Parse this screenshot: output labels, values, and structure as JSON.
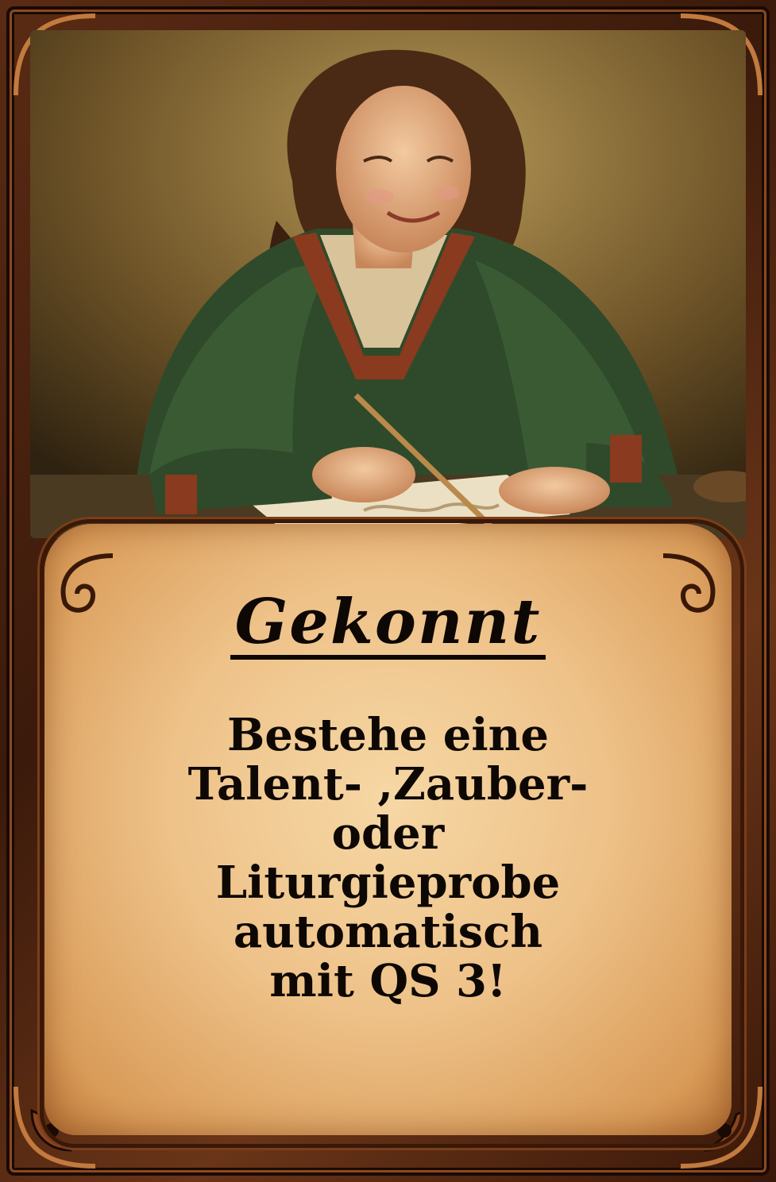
{
  "card": {
    "title": "Gekonnt",
    "text_lines": [
      "Bestehe eine",
      "Talent- ,Zauber-",
      "oder",
      "Liturgieprobe",
      "automatisch",
      "mit QS 3!"
    ]
  },
  "illustration": {
    "subject": "woman-drawing-icon"
  },
  "colors": {
    "frame": "#4a220d",
    "parchment": "#eec289",
    "text": "#0e0805"
  }
}
